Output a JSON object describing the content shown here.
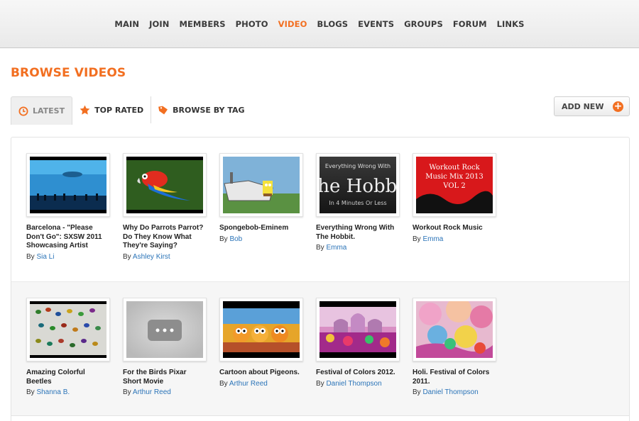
{
  "nav": {
    "items": [
      "MAIN",
      "JOIN",
      "MEMBERS",
      "PHOTO",
      "VIDEO",
      "BLOGS",
      "EVENTS",
      "GROUPS",
      "FORUM",
      "LINKS"
    ],
    "active": "VIDEO",
    "accent_color": "#f26f21"
  },
  "page": {
    "title": "BROWSE VIDEOS"
  },
  "tabs": {
    "latest": "LATEST",
    "top_rated": "TOP RATED",
    "browse_by_tag": "BROWSE BY TAG"
  },
  "add_new": {
    "label": "ADD NEW",
    "icon": "plus-circle-icon"
  },
  "by_label": "By",
  "videos": [
    {
      "title": "Barcelona - \"Please Don't Go\": SXSW 2011 Showcasing Artist",
      "author": "Sia Li",
      "thumb": "aquarium"
    },
    {
      "title": "Why Do Parrots Parrot? Do They Know What They're Saying?",
      "author": "Ashley Kirst",
      "thumb": "parrot"
    },
    {
      "title": "Spongebob-Eminem",
      "author": "Bob",
      "thumb": "spongebob"
    },
    {
      "title": "Everything Wrong With The Hobbit.",
      "author": "Emma",
      "thumb": "hobbit",
      "thumb_text": [
        "Everything Wrong With",
        "The Hobbit",
        "In 4 Minutes Or Less"
      ]
    },
    {
      "title": "Workout Rock Music",
      "author": "Emma",
      "thumb": "workout",
      "thumb_text": [
        "Workout Rock",
        "Music Mix 2013",
        "VOL 2"
      ]
    },
    {
      "title": "Amazing Colorful Beetles",
      "author": "Shanna B.",
      "thumb": "beetles"
    },
    {
      "title": "For the Birds Pixar Short Movie",
      "author": "Arthur Reed",
      "thumb": "placeholder"
    },
    {
      "title": "Cartoon about Pigeons.",
      "author": "Arthur Reed",
      "thumb": "pigeons"
    },
    {
      "title": "Festival of Colors 2012.",
      "author": "Daniel Thompson",
      "thumb": "festival"
    },
    {
      "title": "Holi. Festival of Colors 2011.",
      "author": "Daniel Thompson",
      "thumb": "holi"
    }
  ]
}
